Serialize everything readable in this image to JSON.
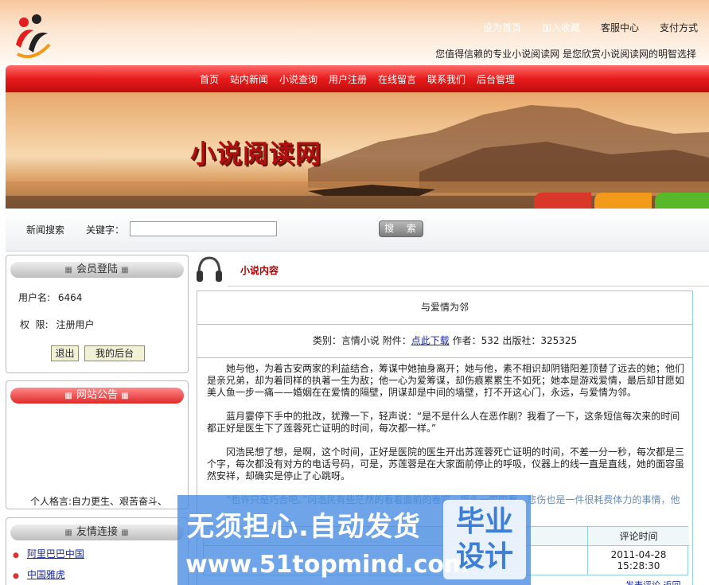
{
  "header": {
    "top_links": [
      "设为首页",
      "加入收藏",
      "客服中心",
      "支付方式"
    ],
    "slogan": "您值得信赖的专业小说阅读网 是您欣赏小说阅读网的明智选择"
  },
  "nav": {
    "items": [
      "首页",
      "站内新闻",
      "小说查询",
      "用户注册",
      "在线留言",
      "联系我们",
      "后台管理"
    ]
  },
  "banner": {
    "title": "小说阅读网"
  },
  "search": {
    "section_label": "新闻搜索",
    "keyword_label": "关键字：",
    "keyword_value": "",
    "button_label": "搜 索"
  },
  "member_box": {
    "title": "会员登陆",
    "username_label": "用户名:",
    "username_value": "6464",
    "permission_label": "权  限:",
    "permission_value": "注册用户",
    "logout_button": "退出",
    "backend_button": "我的后台"
  },
  "notice_box": {
    "title": "网站公告",
    "motto": "个人格言:自力更生、艰苦奋斗、"
  },
  "friends_box": {
    "title": "友情连接",
    "links": [
      "阿里巴巴中国",
      "中国雅虎"
    ]
  },
  "main": {
    "section_title": "小说内容",
    "novel_title": "与爱情为邻",
    "category_label": "类别：",
    "category_value": "言情小说",
    "attachment_label": "附件：",
    "download_link": "点此下载",
    "author_label": "作者：",
    "author_value": "532",
    "publisher_label": "出版社：",
    "publisher_value": "325325",
    "paragraphs": [
      "她与他，为着古安两家的利益结合，筹谋中她抽身离开；她与他，素不相识却阴错阳差顶替了远去的她；他们是亲兄弟，却为着同样的执著一生为敌；他一心为爱筹谋，却伤痕累累生不如死；她本是游戏爱情，最后却甘愿如美人鱼一步一痛——婚姻在在爱情的隔壁，阴谋却是中间的墙壁，打不开这心门，永远，与爱情为邻。",
      "蓝月霎停下手中的批改，犹豫一下，轻声说：“是不是什么人在恶作剧？我看了一下，这条短信每次来的时间都正好是医生下了莲蓉死亡证明的时间，每次都一样。”",
      "冈浩民想了想，是啊，这个时间，正好是医院的医生开出苏莲蓉死亡证明的时间，不差一分一秒，每次都是三个字，每次都没有对方的电话号码，可是，苏莲蓉是在大家面前停止的呼吸，仪器上的线一直是直线，她的面容虽然安祥，却确实是停止了心跳呀。",
      "“也许只是巧合吧。”冈浩民有些茫然的看着面前的卷宗，摇头一叹叹看，悲伤也是一件很耗费体力的事情，他"
    ],
    "comment_time_header": "评论时间",
    "comment_date": "2011-04-28",
    "comment_time": "15:28:30",
    "bottom_links": "发表评论  返回"
  },
  "watermark": {
    "line1": "无须担心.自动发货",
    "line2": "www.51topmind.com",
    "seal_line1": "毕业",
    "seal_line2": "设计"
  },
  "colors": {
    "nav_red": "#e81b1b",
    "title_red": "#b00000",
    "link_blue": "#1a2a9a",
    "border_teal": "#8fd0dc"
  }
}
